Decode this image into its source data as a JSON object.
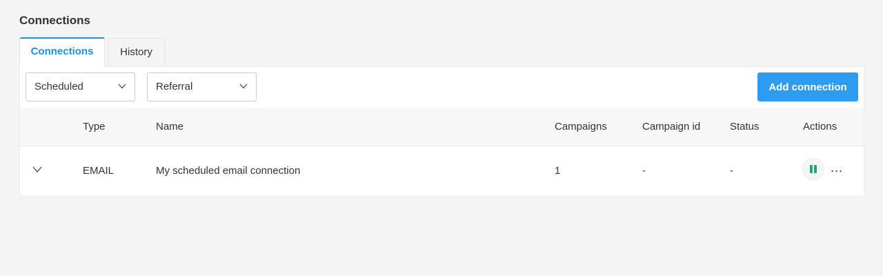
{
  "page": {
    "title": "Connections"
  },
  "tabs": [
    {
      "label": "Connections",
      "active": true
    },
    {
      "label": "History",
      "active": false
    }
  ],
  "filters": {
    "schedule": {
      "value": "Scheduled",
      "icon": "chevron-down-icon"
    },
    "type": {
      "value": "Referral",
      "icon": "chevron-down-icon"
    }
  },
  "actions": {
    "add_connection_label": "Add connection"
  },
  "colors": {
    "accent": "#1e8fe5",
    "button": "#2d9cf0",
    "pause": "#23a672"
  },
  "table": {
    "headers": {
      "type": "Type",
      "name": "Name",
      "campaigns": "Campaigns",
      "campaign_id": "Campaign id",
      "status": "Status",
      "actions": "Actions"
    },
    "rows": [
      {
        "type": "EMAIL",
        "name": "My scheduled email connection",
        "campaigns": "1",
        "campaign_id": "-",
        "status": "-",
        "more_label": "..."
      }
    ]
  }
}
